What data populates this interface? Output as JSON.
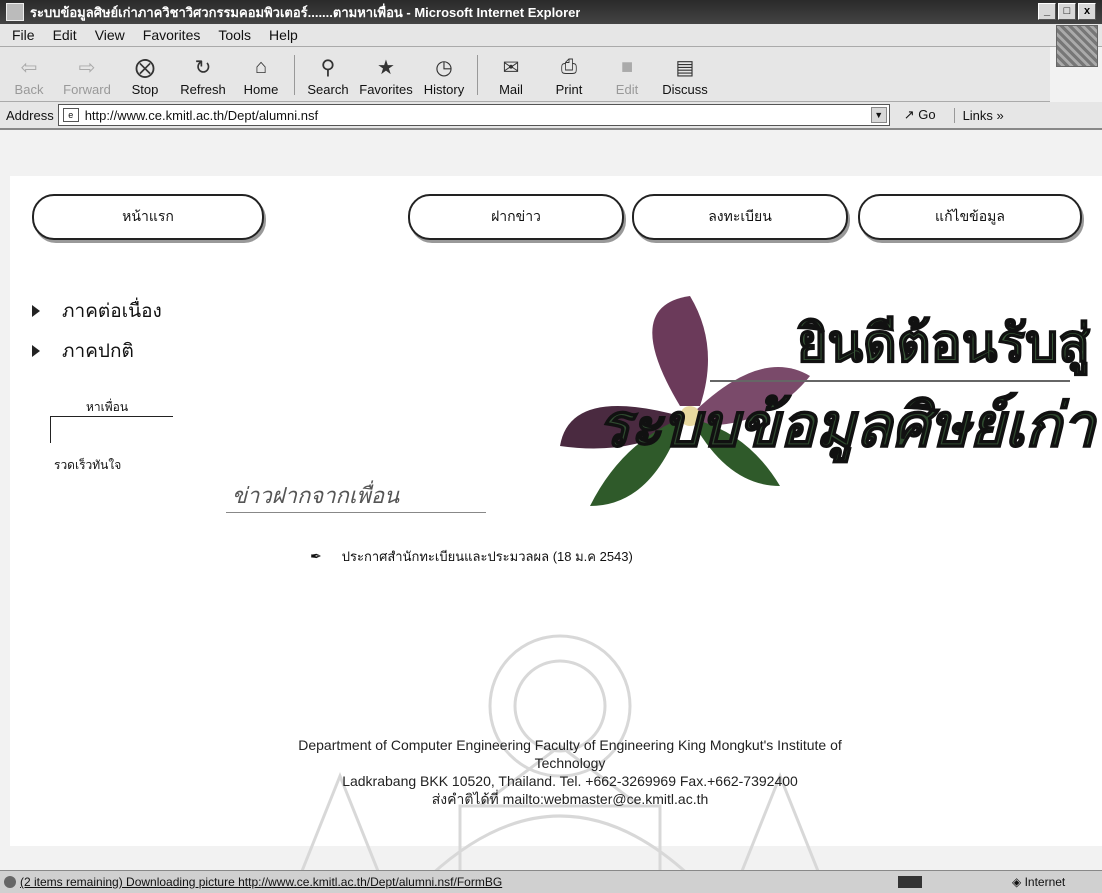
{
  "window": {
    "title": "ระบบข้อมูลศิษย์เก่าภาควิชาวิศวกรรมคอมพิวเตอร์.......ตามหาเพื่อน - Microsoft Internet Explorer",
    "buttons": [
      "_",
      "□",
      "x"
    ]
  },
  "menu": [
    "File",
    "Edit",
    "View",
    "Favorites",
    "Tools",
    "Help"
  ],
  "toolbar": [
    {
      "label": "Back",
      "icon": "back-arrow",
      "disabled": true
    },
    {
      "label": "Forward",
      "icon": "forward-arrow",
      "disabled": true
    },
    {
      "label": "Stop",
      "icon": "stop"
    },
    {
      "label": "Refresh",
      "icon": "refresh"
    },
    {
      "label": "Home",
      "icon": "home"
    },
    {
      "label": "Search",
      "icon": "search"
    },
    {
      "label": "Favorites",
      "icon": "favorites"
    },
    {
      "label": "History",
      "icon": "history"
    },
    {
      "label": "Mail",
      "icon": "mail"
    },
    {
      "label": "Print",
      "icon": "print"
    },
    {
      "label": "Edit",
      "icon": "edit",
      "disabled": true
    },
    {
      "label": "Discuss",
      "icon": "discuss"
    }
  ],
  "address": {
    "label": "Address",
    "url": "http://www.ce.kmitl.ac.th/Dept/alumni.nsf",
    "go": "Go",
    "links": "Links"
  },
  "nav": {
    "home": "หน้าแรก",
    "news": "ฝากข่าว",
    "register": "ลงทะเบียน",
    "edit": "แก้ไขข้อมูล"
  },
  "sidebar": {
    "items": [
      "ภาคต่อเนื่อง",
      "ภาคปกติ"
    ],
    "find_label": "หาเพื่อน",
    "find_sub": "รวดเร็วทันใจ"
  },
  "banner": {
    "line1": "ยินดีต้อนรับสู่",
    "line2": "ระบบข้อมูลศิษย์เก่า"
  },
  "news": {
    "title": "ข่าวฝากจากเพื่อน",
    "item": "ประกาศสำนักทะเบียนและประมวลผล (18 ม.ค 2543)"
  },
  "footer": {
    "line1": "Department of Computer Engineering Faculty of Engineering King Mongkut's Institute of Technology",
    "line2": "Ladkrabang BKK 10520, Thailand. Tel. +662-3269969 Fax.+662-7392400",
    "line3": "ส่งคำติได้ที่ mailto:webmaster@ce.kmitl.ac.th"
  },
  "status": {
    "text": "(2 items remaining) Downloading picture http://www.ce.kmitl.ac.th/Dept/alumni.nsf/FormBG",
    "zone": "Internet"
  }
}
